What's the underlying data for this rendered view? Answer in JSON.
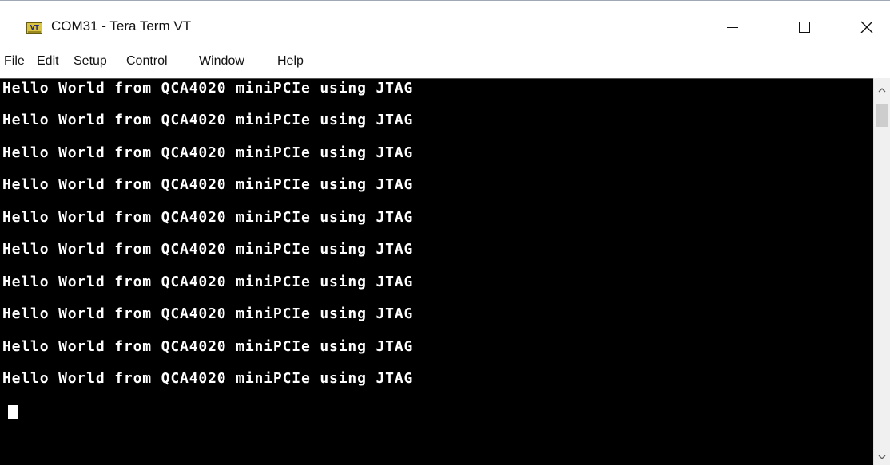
{
  "window": {
    "title": "COM31 - Tera Term VT",
    "icon": "tera-term-vt-icon",
    "icon_label": "VT",
    "controls": {
      "minimize": "minimize-icon",
      "maximize": "maximize-icon",
      "close": "close-icon"
    }
  },
  "menu": {
    "items": [
      {
        "label": "File"
      },
      {
        "label": "Edit"
      },
      {
        "label": "Setup"
      },
      {
        "label": "Control"
      },
      {
        "label": "Window"
      },
      {
        "label": "Help"
      }
    ]
  },
  "terminal": {
    "background": "#000000",
    "foreground": "#ffffff",
    "lines": [
      "Hello World from QCA4020 miniPCIe using JTAG",
      "Hello World from QCA4020 miniPCIe using JTAG",
      "Hello World from QCA4020 miniPCIe using JTAG",
      "Hello World from QCA4020 miniPCIe using JTAG",
      "Hello World from QCA4020 miniPCIe using JTAG",
      "Hello World from QCA4020 miniPCIe using JTAG",
      "Hello World from QCA4020 miniPCIe using JTAG",
      "Hello World from QCA4020 miniPCIe using JTAG",
      "Hello World from QCA4020 miniPCIe using JTAG",
      "Hello World from QCA4020 miniPCIe using JTAG"
    ]
  },
  "scrollbar": {
    "up_icon": "chevron-up-icon",
    "down_icon": "chevron-down-icon"
  }
}
